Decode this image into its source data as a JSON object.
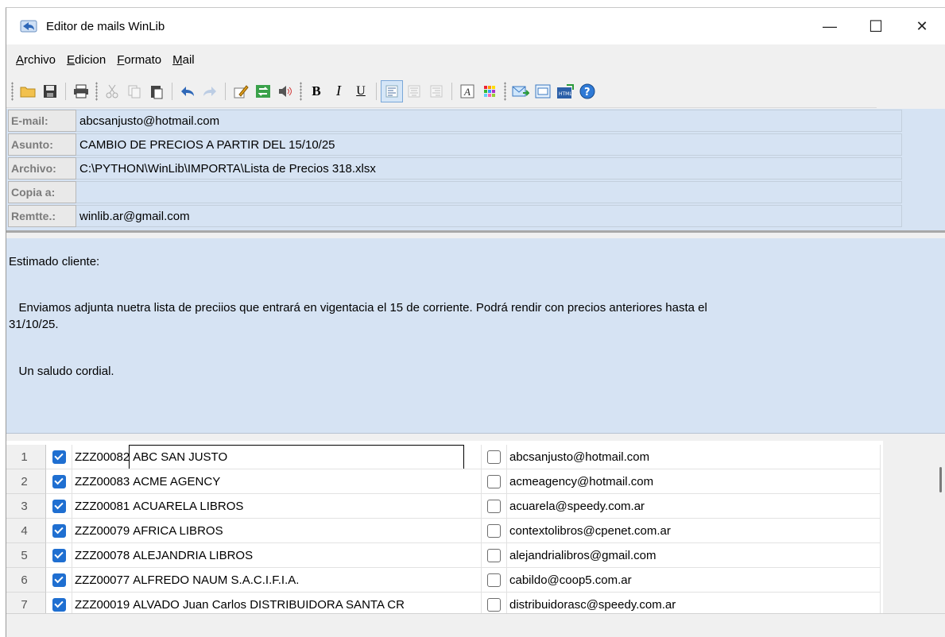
{
  "window": {
    "title": "Editor de mails WinLib",
    "controls": {
      "minimize": "—",
      "maximize": "☐",
      "close": "✕"
    }
  },
  "menu": [
    {
      "accel": "A",
      "rest": "rchivo"
    },
    {
      "accel": "E",
      "rest": "dicion"
    },
    {
      "accel": "F",
      "rest": "ormato"
    },
    {
      "accel": "M",
      "rest": "ail"
    }
  ],
  "toolbar": {
    "bold": "B",
    "italic": "I",
    "underline": "U",
    "icons": [
      "open-folder-icon",
      "save-icon",
      "print-icon",
      "cut-icon",
      "copy-icon",
      "paste-icon",
      "undo-icon",
      "redo-icon",
      "edit-icon",
      "replace-icon",
      "sound-icon",
      "bold-icon",
      "italic-icon",
      "underline-icon",
      "align-left-icon",
      "align-center-icon",
      "align-right-icon",
      "font-icon",
      "color-icon",
      "send-mail-icon",
      "preview-icon",
      "html-icon",
      "help-icon"
    ]
  },
  "header": {
    "email_label": "E-mail:",
    "email_value": "abcsanjusto@hotmail.com",
    "subject_label": "Asunto:",
    "subject_value": "CAMBIO DE PRECIOS A PARTIR DEL 15/10/25",
    "file_label": "Archivo:",
    "file_value": "C:\\PYTHON\\WinLib\\IMPORTA\\Lista de Precios 318.xlsx",
    "cc_label": "Copia a:",
    "cc_value": "",
    "sender_label": "Remtte.:",
    "sender_value": "winlib.ar@gmail.com"
  },
  "body": {
    "greeting": "Estimado cliente:",
    "paragraph_line1": "   Enviamos adjunta nuetra lista de preciios que entrará en vigentacia el 15 de corriente. Podrá rendir con precios anteriores hasta el",
    "paragraph_line2": "31/10/25.",
    "closing": "   Un saludo cordial."
  },
  "recipients": [
    {
      "num": "1",
      "checked": true,
      "code": "ZZZ00082",
      "name": "ABC SAN JUSTO",
      "cc": false,
      "email": "abcsanjusto@hotmail.com"
    },
    {
      "num": "2",
      "checked": true,
      "code": "ZZZ00083",
      "name": "ACME AGENCY",
      "cc": false,
      "email": "acmeagency@hotmail.com"
    },
    {
      "num": "3",
      "checked": true,
      "code": "ZZZ00081",
      "name": "ACUARELA LIBROS",
      "cc": false,
      "email": "acuarela@speedy.com.ar"
    },
    {
      "num": "4",
      "checked": true,
      "code": "ZZZ00079",
      "name": "AFRICA LIBROS",
      "cc": false,
      "email": "contextolibros@cpenet.com.ar"
    },
    {
      "num": "5",
      "checked": true,
      "code": "ZZZ00078",
      "name": "ALEJANDRIA LIBROS",
      "cc": false,
      "email": "alejandrialibros@gmail.com"
    },
    {
      "num": "6",
      "checked": true,
      "code": "ZZZ00077",
      "name": "ALFREDO NAUM S.A.C.I.F.I.A.",
      "cc": false,
      "email": "cabildo@coop5.com.ar"
    },
    {
      "num": "7",
      "checked": true,
      "code": "ZZZ00019",
      "name": "ALVADO Juan Carlos DISTRIBUIDORA SANTA CR",
      "cc": false,
      "email": "distribuidorasc@speedy.com.ar"
    }
  ]
}
